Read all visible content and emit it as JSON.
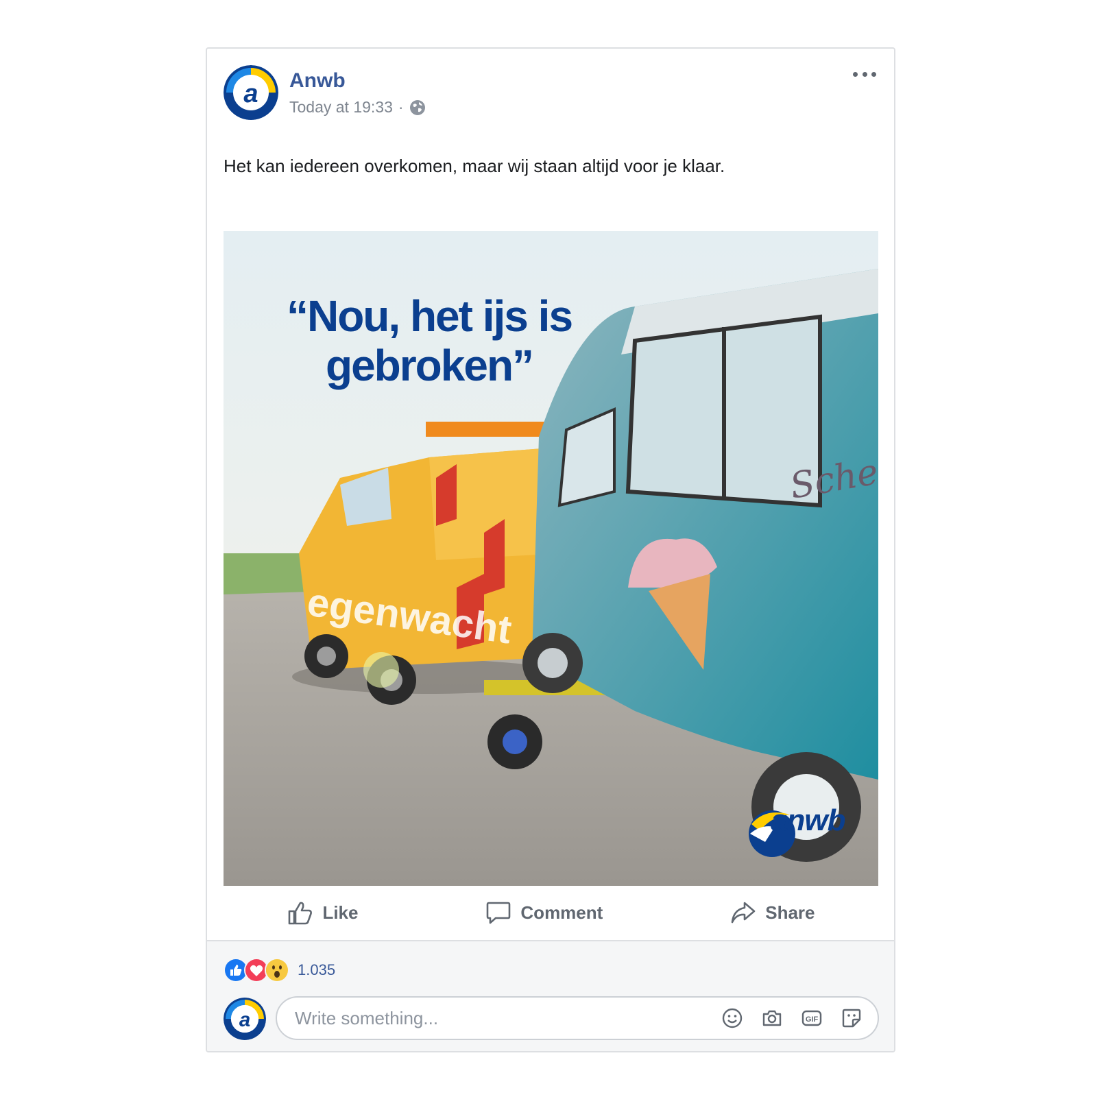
{
  "post": {
    "page_name": "Anwb",
    "timestamp": "Today at 19:33",
    "separator": "·",
    "privacy_icon": "globe-icon",
    "more_icon": "more-options-icon",
    "text": "Het kan iedereen overkomen, maar wij staan altijd voor je klaar."
  },
  "image": {
    "headline_line1": "“Nou, het ijs is",
    "headline_line2": "gebroken”",
    "brand_logo_text": "anwb"
  },
  "actions": {
    "like_label": "Like",
    "comment_label": "Comment",
    "share_label": "Share"
  },
  "reactions": {
    "icons": [
      "like-reaction-icon",
      "love-reaction-icon",
      "wow-reaction-icon"
    ],
    "count": "1.035"
  },
  "comment": {
    "placeholder": "Write something...",
    "icons": [
      "emoji-icon",
      "camera-icon",
      "gif-icon",
      "sticker-icon"
    ]
  },
  "colors": {
    "link_blue": "#385898",
    "brand_blue": "#0b3f8f",
    "brand_yellow": "#ffcc00",
    "like_blue": "#1877f2",
    "love_red": "#f33e58"
  }
}
